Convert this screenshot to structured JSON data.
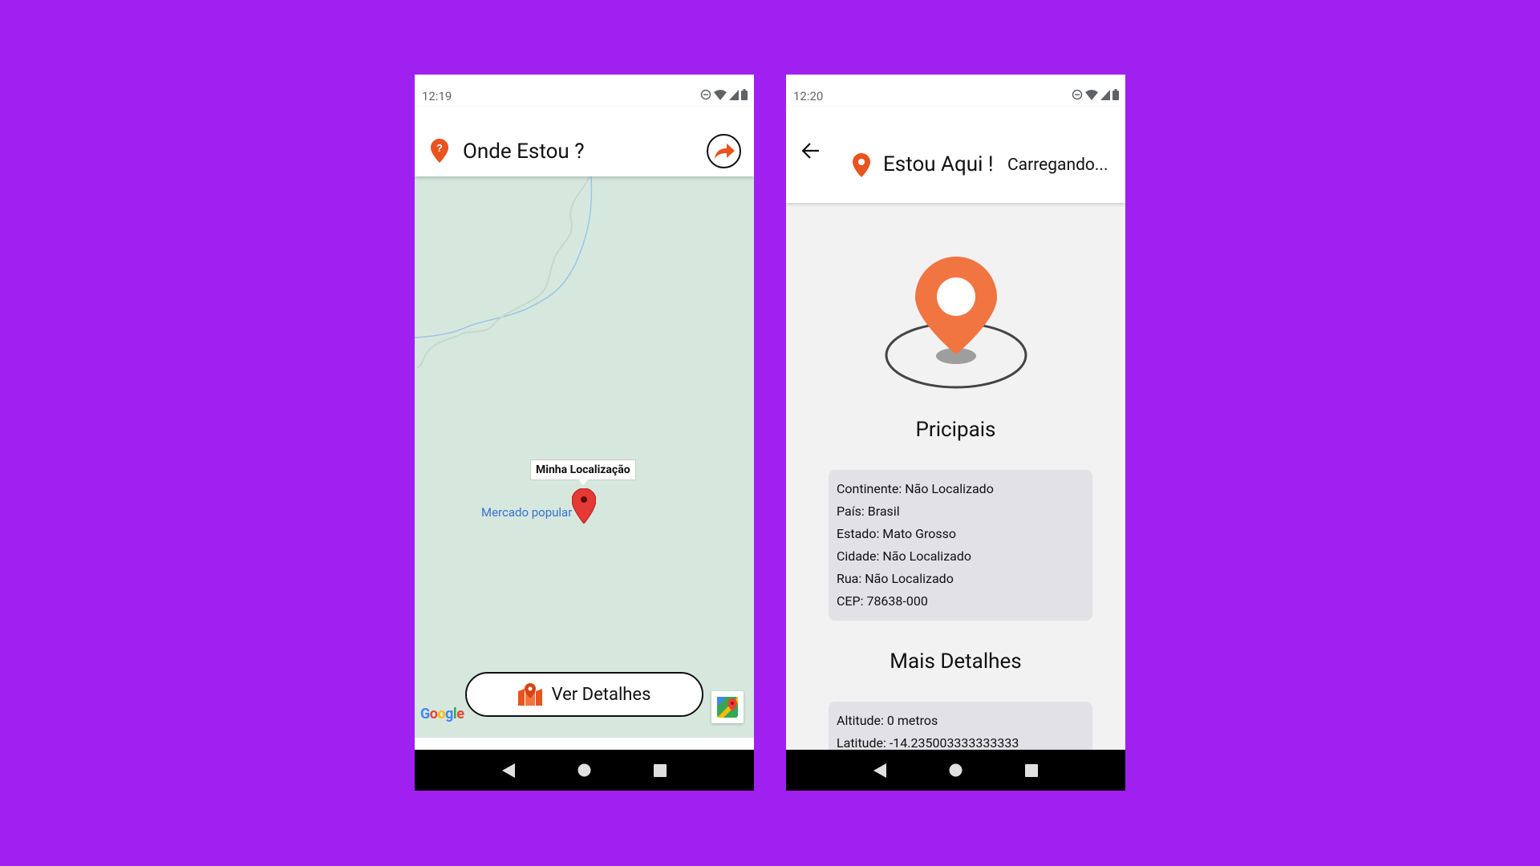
{
  "colors": {
    "background": "#a020f0",
    "accent": "#e8531e",
    "pin_orange": "#f07540",
    "map_bg": "#d6e8de",
    "card_bg": "#e2e2e6"
  },
  "screen1": {
    "status_time": "12:19",
    "app_title": "Onde Estou ?",
    "title_icon": "location-question-icon",
    "share_icon": "share-arrow-icon",
    "map": {
      "tooltip": "Minha Localização",
      "poi_label": "Mercado popular",
      "google_logo": "Google"
    },
    "details_button": "Ver Detalhes"
  },
  "screen2": {
    "status_time": "12:20",
    "app_title": "Estou Aqui !",
    "subtitle": "Carregando...",
    "main_section_title": "Pricipais",
    "main_info": [
      "Continente: Não Localizado",
      "País: Brasil",
      "Estado: Mato Grosso",
      "Cidade: Não Localizado",
      "Rua: Não Localizado",
      "CEP: 78638-000"
    ],
    "details_section_title": "Mais Detalhes",
    "details_info": [
      "Altitude: 0 metros",
      "Latitude: -14.235003333333333"
    ]
  }
}
